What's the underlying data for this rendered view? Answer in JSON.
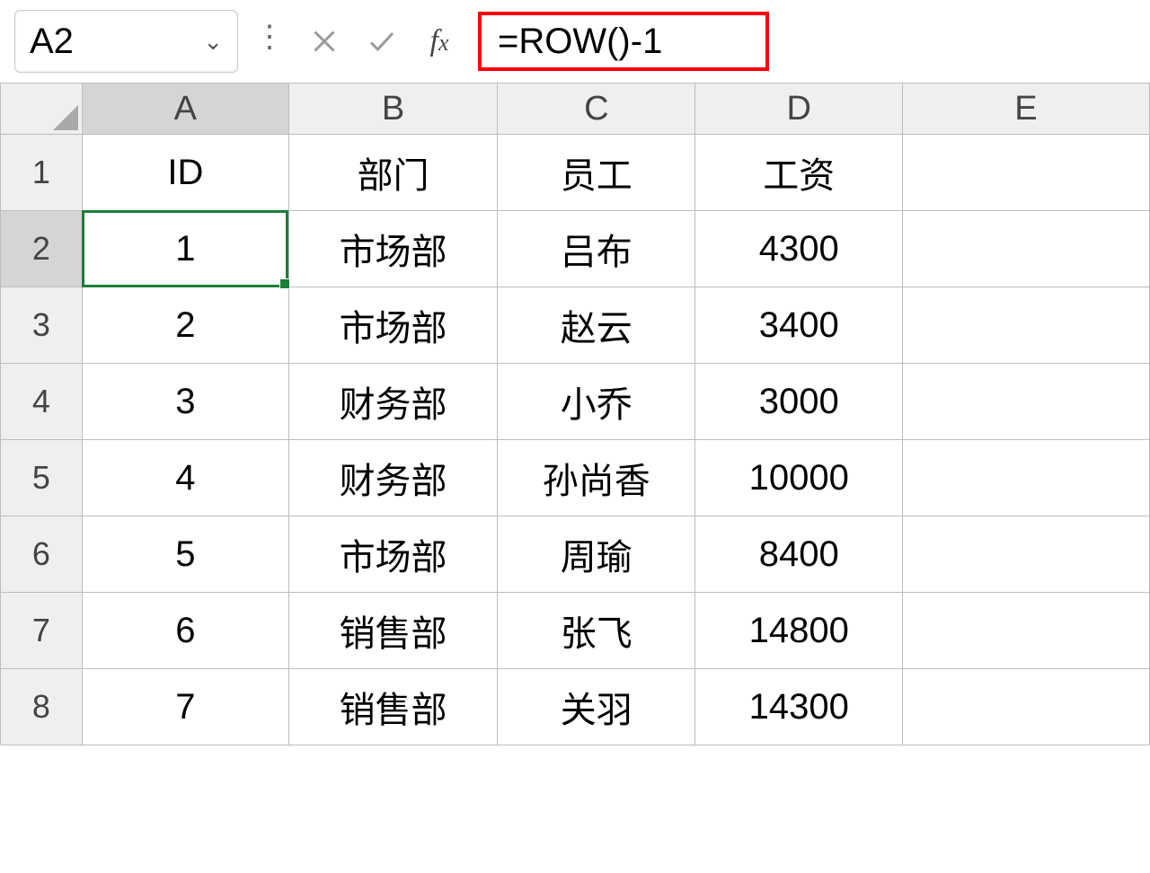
{
  "formula_bar": {
    "cell_ref": "A2",
    "formula": "=ROW()-1"
  },
  "columns": [
    "A",
    "B",
    "C",
    "D",
    "E"
  ],
  "row_numbers": [
    1,
    2,
    3,
    4,
    5,
    6,
    7,
    8
  ],
  "headers": {
    "A": "ID",
    "B": "部门",
    "C": "员工",
    "D": "工资"
  },
  "rows": [
    {
      "A": "1",
      "B": "市场部",
      "C": "吕布",
      "D": "4300"
    },
    {
      "A": "2",
      "B": "市场部",
      "C": "赵云",
      "D": "3400"
    },
    {
      "A": "3",
      "B": "财务部",
      "C": "小乔",
      "D": "3000"
    },
    {
      "A": "4",
      "B": "财务部",
      "C": "孙尚香",
      "D": "10000"
    },
    {
      "A": "5",
      "B": "市场部",
      "C": "周瑜",
      "D": "8400"
    },
    {
      "A": "6",
      "B": "销售部",
      "C": "张飞",
      "D": "14800"
    },
    {
      "A": "7",
      "B": "销售部",
      "C": "关羽",
      "D": "14300"
    }
  ],
  "selected_cell": "A2"
}
